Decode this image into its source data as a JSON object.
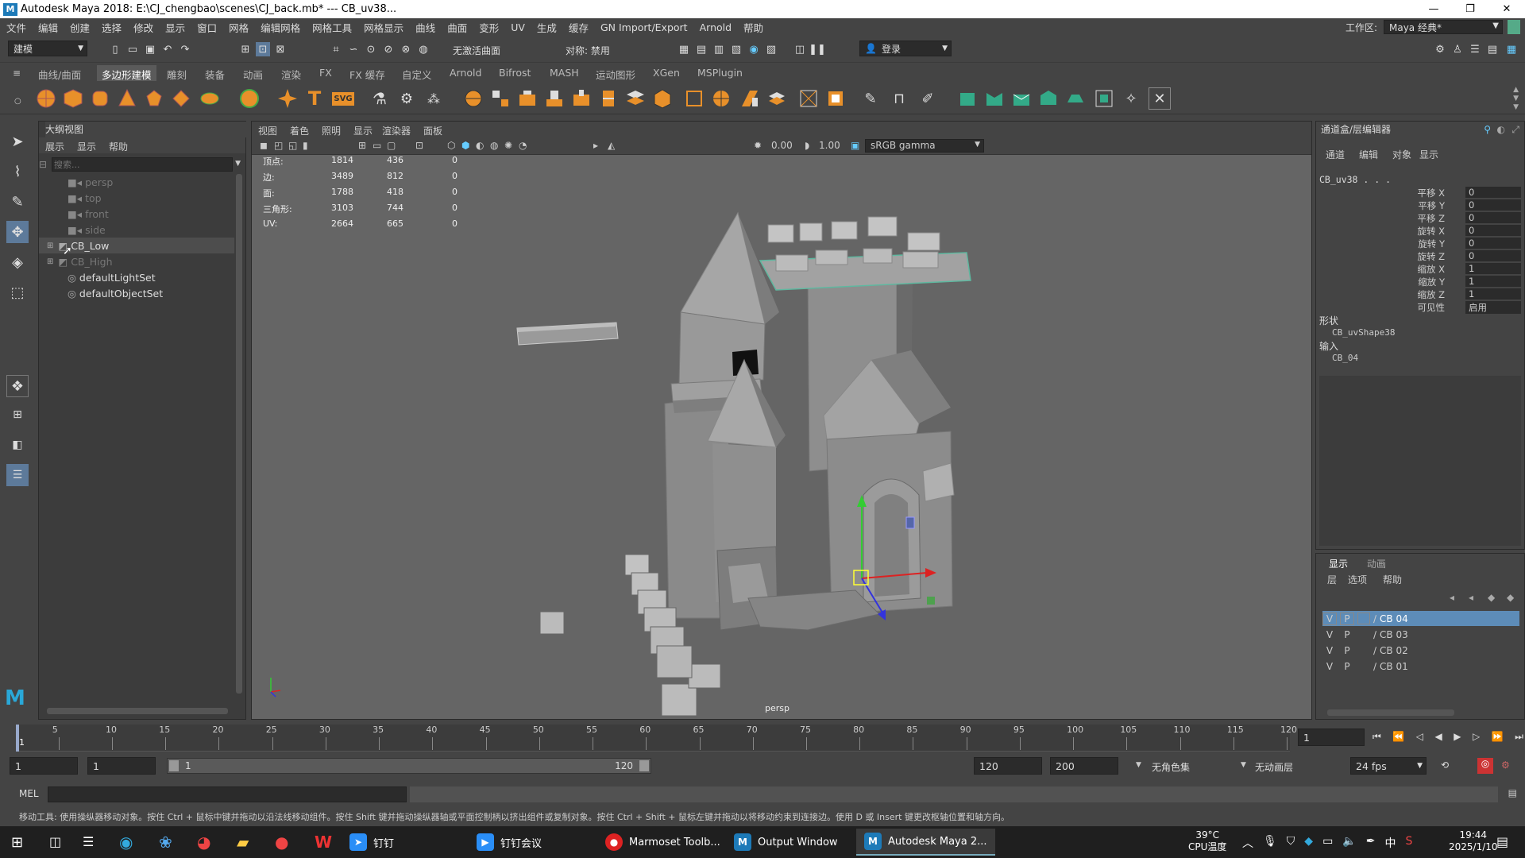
{
  "window": {
    "title": "Autodesk Maya 2018: E:\\CJ_chengbao\\scenes\\CJ_back.mb*   ---   CB_uv38...",
    "minimize": "—",
    "restore": "❐",
    "close": "✕"
  },
  "menubar": {
    "items": [
      "文件",
      "编辑",
      "创建",
      "选择",
      "修改",
      "显示",
      "窗口",
      "网格",
      "编辑网格",
      "网格工具",
      "网格显示",
      "曲线",
      "曲面",
      "变形",
      "UV",
      "生成",
      "缓存",
      "GN Import/Export",
      "Arnold",
      "帮助"
    ],
    "workspace_label": "工作区:",
    "workspace_value": "Maya 经典*"
  },
  "statusline": {
    "mode": "建模",
    "snap_surface": "无激活曲面",
    "symmetry": "对称: 禁用",
    "login": "登录"
  },
  "shelf": {
    "tabs": [
      "曲线/曲面",
      "多边形建模",
      "雕刻",
      "装备",
      "动画",
      "渲染",
      "FX",
      "FX 缓存",
      "自定义",
      "Arnold",
      "Bifrost",
      "MASH",
      "运动图形",
      "XGen",
      "MSPlugin"
    ],
    "active_tab": "多边形建模",
    "svg_label": "SVG",
    "t_label": "T"
  },
  "outliner": {
    "title": "大纲视图",
    "menus": [
      "展示",
      "显示",
      "帮助"
    ],
    "search_placeholder": "搜索...",
    "items": [
      {
        "label": "persp",
        "dim": true
      },
      {
        "label": "top",
        "dim": true
      },
      {
        "label": "front",
        "dim": true
      },
      {
        "label": "side",
        "dim": true
      },
      {
        "label": "CB_Low",
        "dim": false
      },
      {
        "label": "CB_High",
        "dim": true
      },
      {
        "label": "defaultLightSet",
        "dim": false
      },
      {
        "label": "defaultObjectSet",
        "dim": false
      }
    ]
  },
  "viewport": {
    "menus": [
      "视图",
      "着色",
      "照明",
      "显示",
      "渲染器",
      "面板"
    ],
    "exposure": "0.00",
    "gamma": "1.00",
    "colorspace": "sRGB gamma",
    "camera": "persp",
    "hud": [
      {
        "label": "顶点:",
        "a": "1814",
        "b": "436",
        "c": "0"
      },
      {
        "label": "边:",
        "a": "3489",
        "b": "812",
        "c": "0"
      },
      {
        "label": "面:",
        "a": "1788",
        "b": "418",
        "c": "0"
      },
      {
        "label": "三角形:",
        "a": "3103",
        "b": "744",
        "c": "0"
      },
      {
        "label": "UV:",
        "a": "2664",
        "b": "665",
        "c": "0"
      }
    ]
  },
  "channelbox": {
    "title": "通道盒/层编辑器",
    "menus": [
      "通道",
      "编辑",
      "对象",
      "显示"
    ],
    "object": "CB_uv38 . . .",
    "channels": [
      {
        "label": "平移 X",
        "value": "0"
      },
      {
        "label": "平移 Y",
        "value": "0"
      },
      {
        "label": "平移 Z",
        "value": "0"
      },
      {
        "label": "旋转 X",
        "value": "0"
      },
      {
        "label": "旋转 Y",
        "value": "0"
      },
      {
        "label": "旋转 Z",
        "value": "0"
      },
      {
        "label": "缩放 X",
        "value": "1"
      },
      {
        "label": "缩放 Y",
        "value": "1"
      },
      {
        "label": "缩放 Z",
        "value": "1"
      },
      {
        "label": "可见性",
        "value": "启用"
      }
    ],
    "shapes_label": "形状",
    "shape_name": "CB_uvShape38",
    "inputs_label": "输入",
    "input_name": "CB_04"
  },
  "layers": {
    "tabs": [
      "显示",
      "动画"
    ],
    "menus": [
      "层",
      "选项",
      "帮助"
    ],
    "rows": [
      {
        "v": "V",
        "p": "P",
        "name": "CB 04",
        "selected": true
      },
      {
        "v": "V",
        "p": "P",
        "name": "CB 03",
        "selected": false
      },
      {
        "v": "V",
        "p": "P",
        "name": "CB 02",
        "selected": false
      },
      {
        "v": "V",
        "p": "P",
        "name": "CB 01",
        "selected": false
      }
    ]
  },
  "timeline": {
    "ticks": [
      "5",
      "10",
      "15",
      "20",
      "25",
      "30",
      "35",
      "40",
      "45",
      "50",
      "55",
      "60",
      "65",
      "70",
      "75",
      "80",
      "85",
      "90",
      "95",
      "100",
      "105",
      "110",
      "115",
      "120"
    ],
    "current_frame": "1",
    "current_field": "1"
  },
  "range": {
    "start": "1",
    "playback_start": "1",
    "slider_start": "1",
    "slider_end": "120",
    "playback_end": "120",
    "end": "200",
    "char_set": "无角色集",
    "anim_layer": "无动画层",
    "fps": "24 fps"
  },
  "cmdline": {
    "label": "MEL"
  },
  "helpline": {
    "text": "移动工具: 使用操纵器移动对象。按住 Ctrl + 鼠标中键并拖动以沿法线移动组件。按住 Shift 键并拖动操纵器轴或平面控制柄以挤出组件或复制对象。按住 Ctrl + Shift + 鼠标左键并拖动以将移动约束到连接边。使用 D 或 Insert 键更改枢轴位置和轴方向。"
  },
  "taskbar": {
    "apps": [
      "钉钉",
      "钉钉会议",
      "Marmoset Toolb...",
      "Output Window",
      "Autodesk Maya 2..."
    ],
    "temp": "39°C",
    "temp_label": "CPU温度",
    "ime": "中",
    "time": "19:44",
    "date": "2025/1/10"
  }
}
